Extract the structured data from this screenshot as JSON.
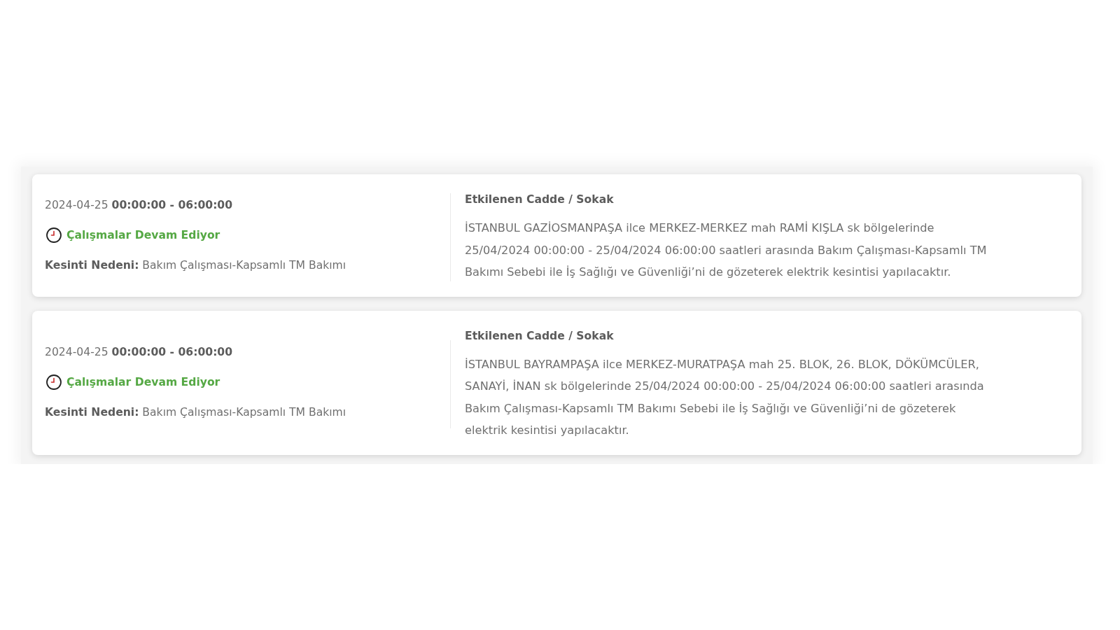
{
  "outages": [
    {
      "date_time": "2024-04-25 **00:00:00 - 06:00:00**",
      "status": "Çalışmalar Devam Ediyor",
      "reason": "**Kesinti Nedeni:** Bakım Çalışması-Kapsamlı TM Bakımı",
      "streets_heading": "Etkilenen Cadde / Sokak",
      "description": "İSTANBUL GAZİOSMANPAŞA ilce MERKEZ-MERKEZ mah RAMİ KIŞLA sk bölgelerinde 25/04/2024 00:00:00 - 25/04/2024 06:00:00 saatleri arasında Bakım Çalışması-Kapsamlı TM Bakımı Sebebi ile İş Sağlığı ve Güvenliği’ni de gözeterek elektrik kesintisi yapılacaktır."
    },
    {
      "date_time": "2024-04-25 **00:00:00 - 06:00:00**",
      "status": "Çalışmalar Devam Ediyor",
      "reason": "**Kesinti Nedeni:** Bakım Çalışması-Kapsamlı TM Bakımı",
      "streets_heading": "Etkilenen Cadde / Sokak",
      "description": "İSTANBUL BAYRAMPAŞA ilce MERKEZ-MURATPAŞA mah 25. BLOK, 26. BLOK, DÖKÜMCÜLER, SANAYİ, İNAN sk bölgelerinde 25/04/2024 00:00:00 - 25/04/2024 06:00:00 saatleri arasında Bakım Çalışması-Kapsamlı TM Bakımı Sebebi ile İş Sağlığı ve Güvenliği’ni de gözeterek elektrik kesintisi yapılacaktır."
    }
  ]
}
